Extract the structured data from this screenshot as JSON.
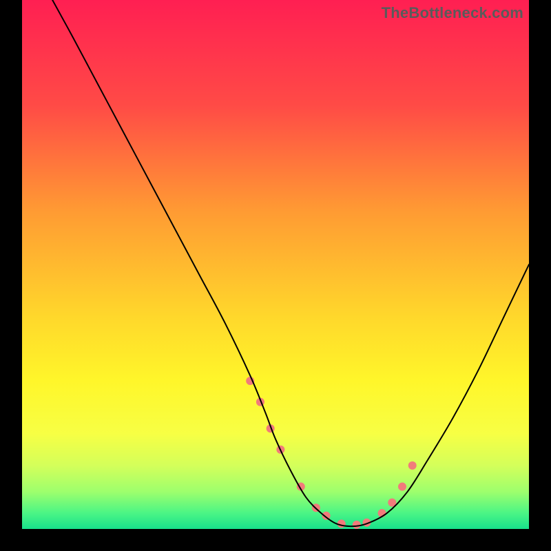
{
  "watermark": "TheBottleneck.com",
  "chart_data": {
    "type": "line",
    "title": "",
    "xlabel": "",
    "ylabel": "",
    "xlim": [
      0,
      100
    ],
    "ylim": [
      0,
      100
    ],
    "grid": false,
    "legend": false,
    "background_gradient_stops": [
      {
        "offset": 0.0,
        "color": "#ff1f52"
      },
      {
        "offset": 0.2,
        "color": "#ff4b46"
      },
      {
        "offset": 0.4,
        "color": "#ff9b33"
      },
      {
        "offset": 0.6,
        "color": "#ffd82b"
      },
      {
        "offset": 0.72,
        "color": "#fff62a"
      },
      {
        "offset": 0.82,
        "color": "#f7ff44"
      },
      {
        "offset": 0.88,
        "color": "#d4ff5a"
      },
      {
        "offset": 0.93,
        "color": "#9dff6d"
      },
      {
        "offset": 0.97,
        "color": "#4bf585"
      },
      {
        "offset": 1.0,
        "color": "#18e08b"
      }
    ],
    "series": [
      {
        "name": "bottleneck-curve",
        "stroke": "#000000",
        "stroke_width": 2,
        "x": [
          6,
          10,
          15,
          20,
          25,
          30,
          35,
          40,
          45,
          48,
          50,
          53,
          56,
          59,
          62,
          65,
          68,
          72,
          76,
          80,
          85,
          90,
          95,
          100
        ],
        "y": [
          100,
          93,
          84,
          75,
          66,
          57,
          48,
          39,
          29,
          22,
          17,
          11,
          6,
          3,
          1,
          0.5,
          1,
          3,
          7,
          13,
          21,
          30,
          40,
          50
        ]
      }
    ],
    "highlight_points": {
      "name": "sample-markers",
      "fill": "#f17b7b",
      "radius": 6,
      "x": [
        45,
        47,
        49,
        51,
        55,
        58,
        60,
        63,
        66,
        68,
        71,
        73,
        75,
        77
      ],
      "y": [
        28,
        24,
        19,
        15,
        8,
        4,
        2.5,
        1,
        0.8,
        1.2,
        3,
        5,
        8,
        12
      ]
    }
  }
}
